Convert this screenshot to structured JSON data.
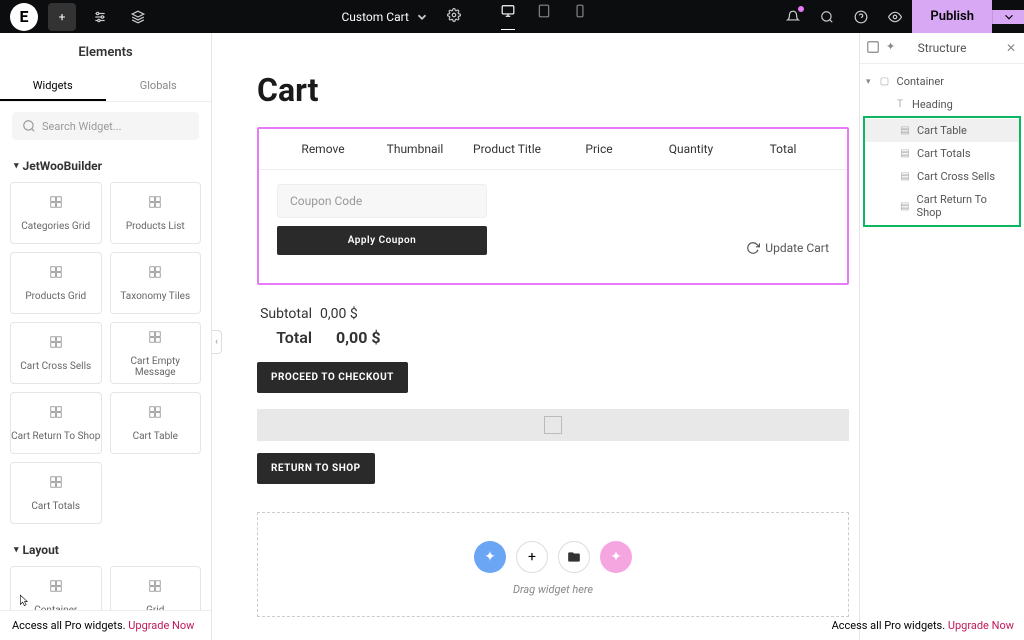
{
  "topbar": {
    "pagename": "Custom Cart",
    "publish": "Publish"
  },
  "leftbar": {
    "title": "Elements",
    "tabs": {
      "widgets": "Widgets",
      "globals": "Globals"
    },
    "search_ph": "Search Widget...",
    "section1": "JetWooBuilder",
    "section2": "Layout",
    "widgets1": [
      {
        "label": "Categories Grid"
      },
      {
        "label": "Products List"
      },
      {
        "label": "Products Grid"
      },
      {
        "label": "Taxonomy Tiles"
      },
      {
        "label": "Cart Cross Sells"
      },
      {
        "label": "Cart Empty Message"
      },
      {
        "label": "Cart Return To Shop"
      },
      {
        "label": "Cart Table"
      },
      {
        "label": "Cart Totals"
      }
    ],
    "widgets2": [
      {
        "label": "Container"
      },
      {
        "label": "Grid"
      }
    ],
    "footer_text": "Access all Pro widgets. ",
    "footer_link": "Upgrade Now"
  },
  "canvas": {
    "title": "Cart",
    "headers": {
      "remove": "Remove",
      "thumb": "Thumbnail",
      "ptitle": "Product Title",
      "price": "Price",
      "qty": "Quantity",
      "total": "Total"
    },
    "coupon_ph": "Coupon Code",
    "apply": "Apply Coupon",
    "update": "Update Cart",
    "subtotal_l": "Subtotal",
    "subtotal_v": "0,00 $",
    "total_l": "Total",
    "total_v": "0,00 $",
    "checkout": "PROCEED TO CHECKOUT",
    "return": "RETURN TO SHOP",
    "drag": "Drag widget here"
  },
  "rightbar": {
    "title": "Structure",
    "tree": {
      "container": "Container",
      "heading": "Heading",
      "cart_table": "Cart Table",
      "cart_totals": "Cart Totals",
      "cross": "Cart Cross Sells",
      "return": "Cart Return To Shop"
    },
    "footer_text": "Access all Pro widgets. ",
    "footer_link": "Upgrade Now"
  }
}
